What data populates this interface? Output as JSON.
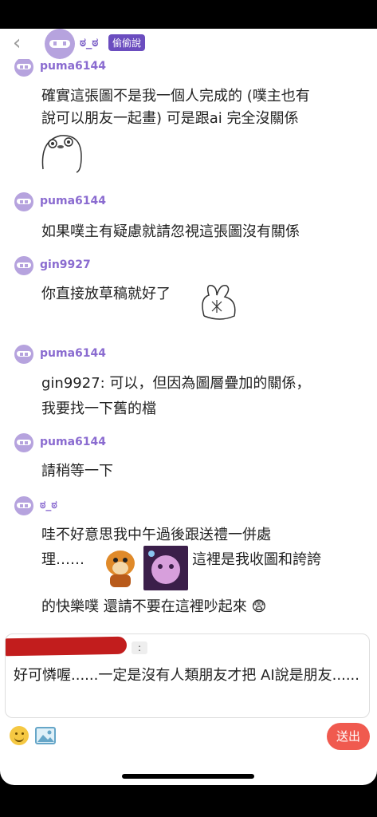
{
  "header": {
    "back_icon": "chevron-left-icon",
    "name": "ಠ_ಠ",
    "badge": "偷偷說"
  },
  "messages": [
    {
      "user": "puma6144",
      "lines": [
        "確實這張圖不是我一個人完成的 (噗主也有",
        "說可以朋友一起畫) 可是跟ai 完全沒關係"
      ],
      "sticker": "face-sticker"
    },
    {
      "user": "puma6144",
      "lines": [
        "如果噗主有疑慮就請忽視這張圖沒有關係"
      ]
    },
    {
      "user": "gin9927",
      "lines": [
        "你直接放草稿就好了"
      ],
      "sticker": "rabbit-sticker"
    },
    {
      "user": "puma6144",
      "lines": [
        "gin9927: 可以，但因為圖層疊加的關係，",
        "我要找一下舊的檔"
      ]
    },
    {
      "user": "puma6144",
      "lines": [
        "請稍等一下"
      ]
    },
    {
      "user": "ಠ_ಠ",
      "lines": [
        "哇不好意思我中午過後跟送禮一併處",
        "理……",
        "這裡是我收圖和誇誇",
        "的快樂噗 還請不要在這裡吵起來 😨"
      ]
    }
  ],
  "reply": {
    "colon": ":",
    "text": "好可憐喔......一定是沒有人類朋友才把 AI說是朋友......"
  },
  "toolbar": {
    "send_label": "送出",
    "emoji_icon": "emoji-icon",
    "image_icon": "image-icon"
  },
  "colors": {
    "accent": "#8a6bd0",
    "send": "#f05a4f",
    "redaction": "#c21d1d"
  }
}
